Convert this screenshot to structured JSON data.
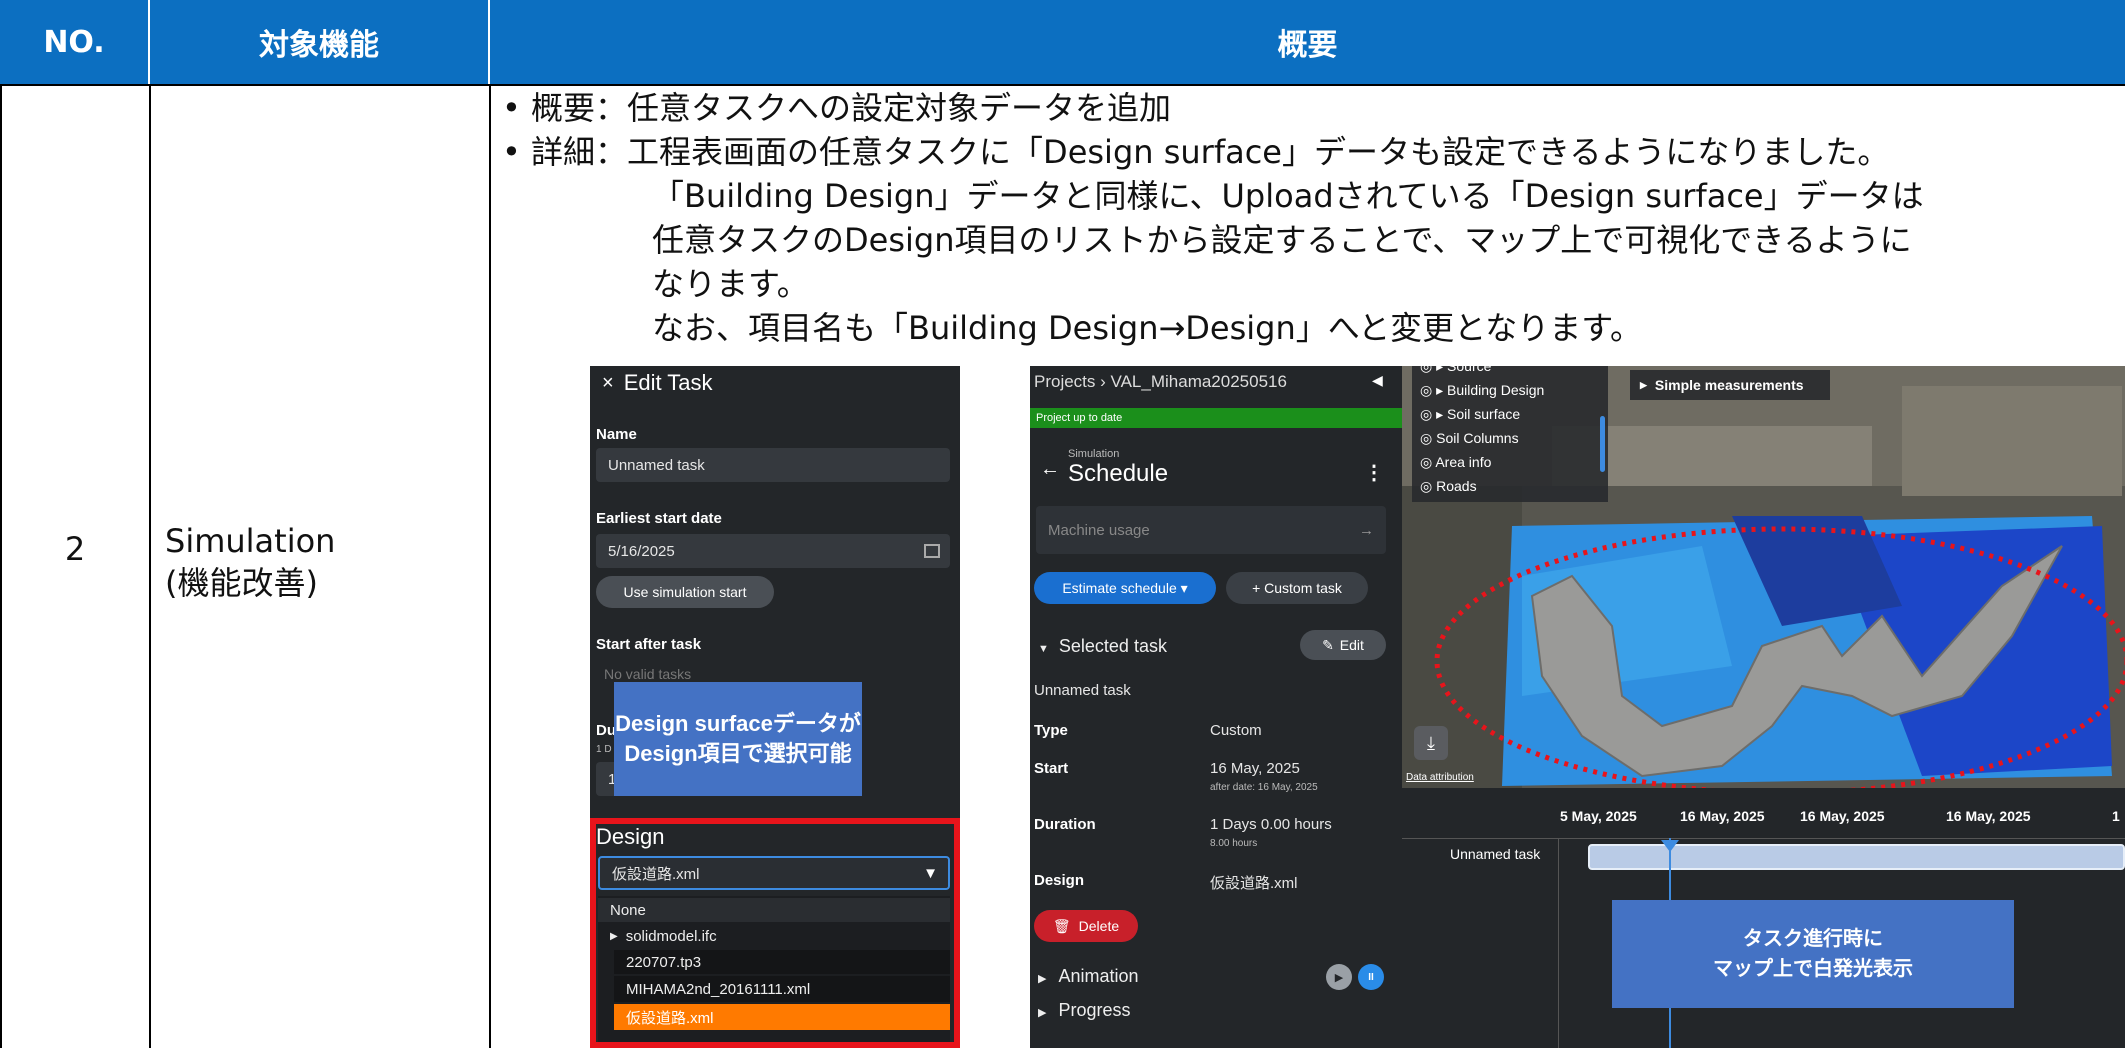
{
  "table": {
    "headers": {
      "no": "NO.",
      "target": "対象機能",
      "summary": "概要"
    },
    "row": {
      "no": "2",
      "target_line1": "Simulation",
      "target_line2": "(機能改善)",
      "bullet1": "• 概要：任意タスクへの設定対象データを追加",
      "bullet2": "• 詳細：工程表画面の任意タスクに「Design surface」データも設定できるようになりました。",
      "detail1": "「Building Design」データと同様に、Uploadされている「Design surface」データは",
      "detail2": "任意タスクのDesign項目のリストから設定することで、マップ上で可視化できるように",
      "detail3": "なります。",
      "detail4": "なお、項目名も「Building Design→Design」へと変更となります。"
    }
  },
  "edit_task": {
    "title": "Edit Task",
    "close_icon": "×",
    "name_label": "Name",
    "name_value": "Unnamed task",
    "earliest_label": "Earliest start date",
    "earliest_value": "5/16/2025",
    "use_sim_button": "Use simulation start",
    "start_after_label": "Start after task",
    "start_after_value": "No valid tasks",
    "du_label": "Du",
    "du_sub": "1 D",
    "du_value": "1",
    "design_label": "Design",
    "design_selected": "仮設道路.xml",
    "dropdown_arrow": "▼",
    "options": [
      "None",
      "solidmodel.ifc",
      "220707.tp3",
      "MIHAMA2nd_20161111.xml",
      "仮設道路.xml"
    ],
    "callout_line1": "Design surfaceデータが",
    "callout_line2": "Design項目で選択可能"
  },
  "schedule": {
    "breadcrumb": "Projects › VAL_Mihama20250516",
    "status": "Project up to date",
    "section_small": "Simulation",
    "title": "Schedule",
    "machine_usage": "Machine usage",
    "estimate_button": "Estimate schedule ▾",
    "custom_task_button": "+ Custom task",
    "selected_task": "Selected task",
    "edit_button": "Edit",
    "task_name": "Unnamed task",
    "type_label": "Type",
    "type_value": "Custom",
    "start_label": "Start",
    "start_value": "16 May, 2025",
    "start_sub": "after date: 16 May, 2025",
    "duration_label": "Duration",
    "duration_value": "1 Days 0.00 hours",
    "duration_sub": "8.00 hours",
    "design_label": "Design",
    "design_value": "仮設道路.xml",
    "delete_button": "Delete",
    "animation": "Animation",
    "progress": "Progress"
  },
  "map": {
    "layers": [
      "Source",
      "Building Design",
      "Soil surface",
      "Soil Columns",
      "Area info",
      "Roads"
    ],
    "simple_measurements": "Simple measurements",
    "attribution": "Data attribution",
    "timeline_dates": [
      "5 May, 2025",
      "16 May, 2025",
      "16 May, 2025",
      "16 May, 2025",
      "1"
    ],
    "timeline_task": "Unnamed task",
    "callout_line1": "タスク進行時に",
    "callout_line2": "マップ上で白発光表示"
  },
  "colors": {
    "header_blue": "#0c6fc1",
    "callout_blue": "#4472c4",
    "highlight_red": "#e8141b",
    "selected_orange": "#ff7a00",
    "status_green": "#1b8f1b",
    "accent_blue": "#1a6fd0",
    "delete_red": "#c8202a"
  }
}
